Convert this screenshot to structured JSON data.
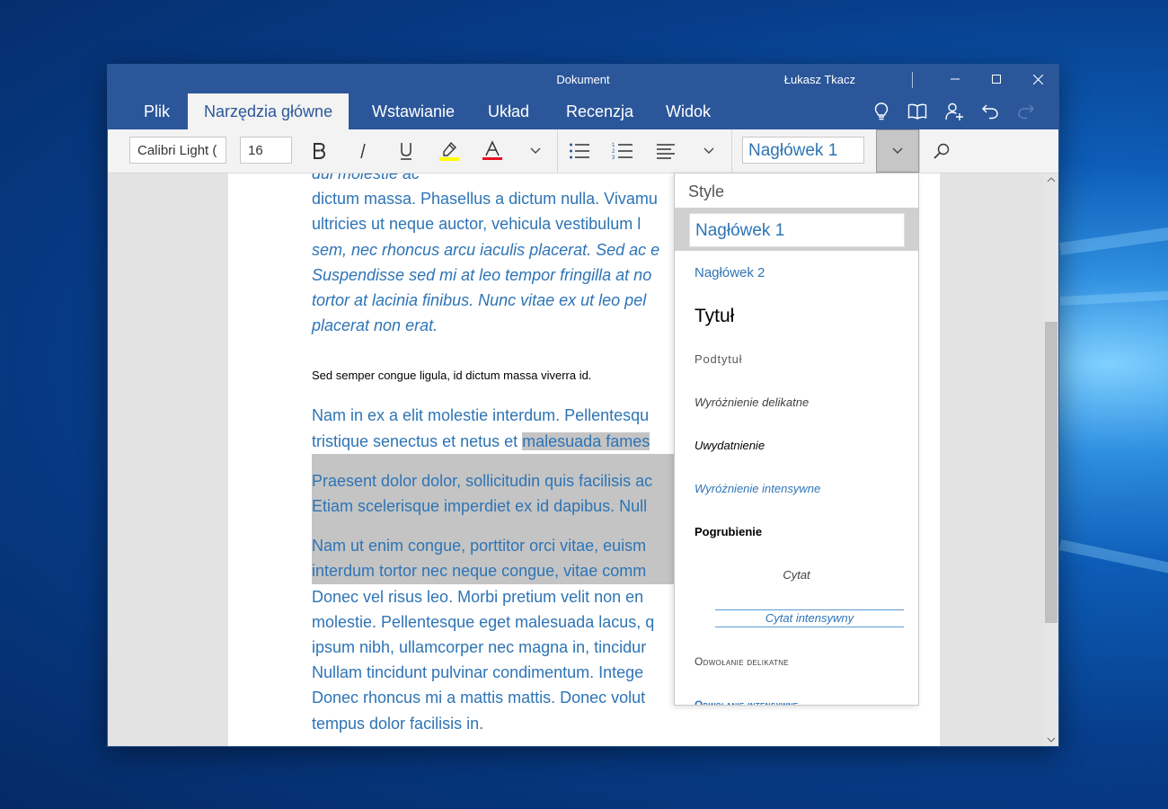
{
  "window": {
    "title": "Dokument",
    "user": "Łukasz Tkacz"
  },
  "tabs": [
    {
      "label": "Plik",
      "active": false
    },
    {
      "label": "Narzędzia główne",
      "active": true
    },
    {
      "label": "Wstawianie",
      "active": false
    },
    {
      "label": "Układ",
      "active": false
    },
    {
      "label": "Recenzja",
      "active": false
    },
    {
      "label": "Widok",
      "active": false
    }
  ],
  "ribbon_icons": [
    "lightbulb-icon",
    "book-icon",
    "share-person-icon",
    "undo-icon",
    "redo-icon"
  ],
  "toolbar": {
    "font_name": "Calibri Light (",
    "font_size": "16",
    "current_style": "Nagłówek 1",
    "highlight_color": "#ffff00",
    "font_color": "#e81123"
  },
  "colors": {
    "accent": "#2b579a",
    "heading_text": "#2e74b5",
    "selection": "#c4c4c4",
    "spell_error": "#e81123"
  },
  "document": {
    "top_cut": "dui molestie ac",
    "para1": [
      "dictum massa. Phasellus a dictum nulla. Vivamu",
      "ultricies ut neque auctor, vehicula vestibulum l",
      "sem, nec rhoncus arcu iaculis placerat. Sed ac e",
      "Suspendisse sed mi at leo tempor fringilla at no",
      "tortor at lacinia finibus. Nunc vitae ex ut leo pel",
      "placerat non erat."
    ],
    "small_line": "Sed semper congue ligula, id dictum massa viverra id.",
    "para2": [
      "Nam in ex a elit molestie interdum. Pellentesqu",
      "tristique senectus et netus et malesuada fames"
    ],
    "para3": [
      "Praesent dolor dolor, sollicitudin quis facilisis ac",
      "Etiam scelerisque imperdiet ex id dapibus. Null"
    ],
    "para4": [
      "Nam ut enim congue, porttitor orci vitae, euism",
      "interdum tortor nec neque congue, vitae comm",
      "Donec vel risus leo. Morbi pretium velit non en",
      "molestie. Pellentesque eget malesuada lacus, q",
      "ipsum nibh, ullamcorper nec magna in, tincidur",
      "Nullam tincidunt pulvinar condimentum. Intege",
      "Donec rhoncus mi a mattis mattis. Donec volut",
      "tempus dolor facilisis in."
    ]
  },
  "style_panel": {
    "title": "Style",
    "items": [
      {
        "label": "Nagłówek 1",
        "selected": true
      },
      {
        "label": "Nagłówek 2"
      },
      {
        "label": "Tytuł"
      },
      {
        "label": "Podtytuł"
      },
      {
        "label": "Wyróżnienie delikatne"
      },
      {
        "label": "Uwydatnienie"
      },
      {
        "label": "Wyróżnienie intensywne"
      },
      {
        "label": "Pogrubienie"
      },
      {
        "label": "Cytat"
      },
      {
        "label": "Cytat intensywny"
      },
      {
        "label": "Odwołanie delikatne"
      },
      {
        "label": "Odwołanie intensywne"
      }
    ]
  }
}
